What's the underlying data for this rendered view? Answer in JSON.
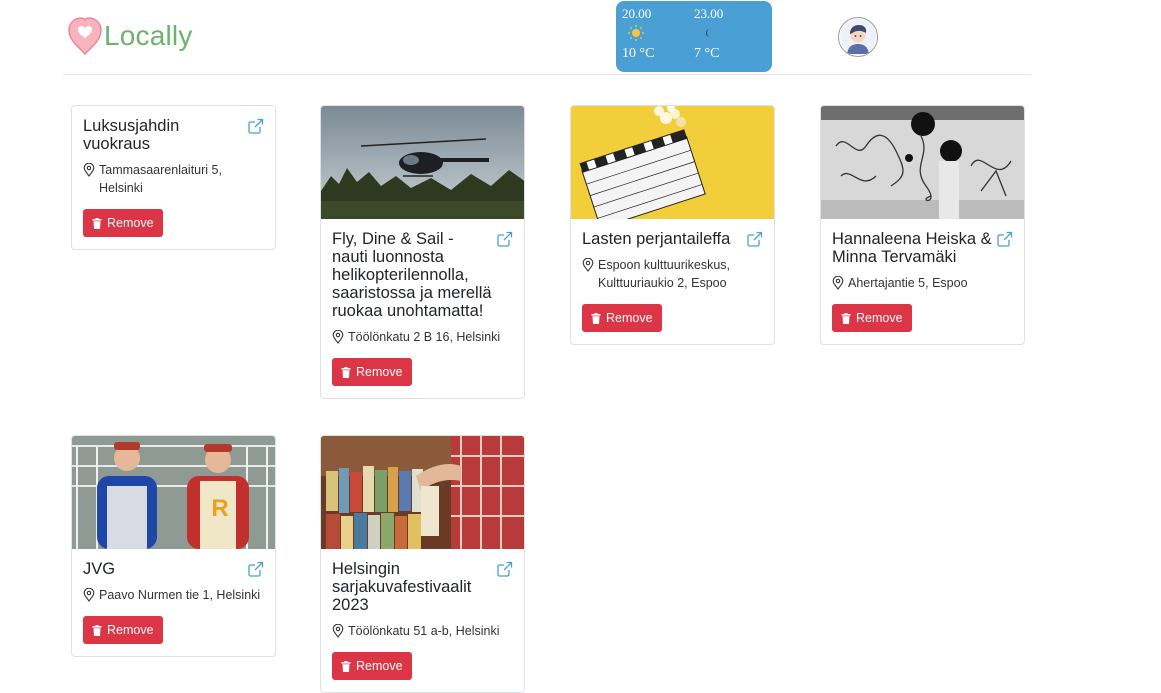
{
  "app": {
    "name": "Locally"
  },
  "weather": [
    {
      "time": "20.00",
      "icon": "sun-icon",
      "temp": "10 °C"
    },
    {
      "time": "23.00",
      "icon": "moon-icon",
      "temp": "7 °C"
    }
  ],
  "cards": [
    {
      "title": "Luksusjahdin vuokraus",
      "location": "Tammasaarenlaituri 5, Helsinki",
      "remove": "Remove",
      "image": "none"
    },
    {
      "title": "Fly, Dine & Sail - nauti luonnosta helikopterilennolla, saaristossa ja merellä ruokaa unohtamatta!",
      "location": "Töölönkatu 2 B 16, Helsinki",
      "remove": "Remove",
      "image": "helicopter-photo"
    },
    {
      "title": "Lasten perjantaileffa",
      "location": "Espoon kulttuurikeskus, Kulttuuriaukio 2, Espoo",
      "remove": "Remove",
      "image": "clapperboard-photo"
    },
    {
      "title": "Hannaleena Heiska & Minna Tervamäki",
      "location": "Ahertajantie 5, Espoo",
      "remove": "Remove",
      "image": "art-photo"
    },
    {
      "title": "JVG",
      "location": "Paavo Nurmen tie 1, Helsinki",
      "remove": "Remove",
      "image": "band-photo"
    },
    {
      "title": "Helsingin sarjakuvafestivaalit 2023",
      "location": "Töölönkatu 51 a-b, Helsinki",
      "remove": "Remove",
      "image": "comics-photo"
    }
  ],
  "colors": {
    "accent": "#6fb16f",
    "weather_bg": "#4a9fd4",
    "danger": "#dc3545",
    "link": "#4a9fd4"
  }
}
